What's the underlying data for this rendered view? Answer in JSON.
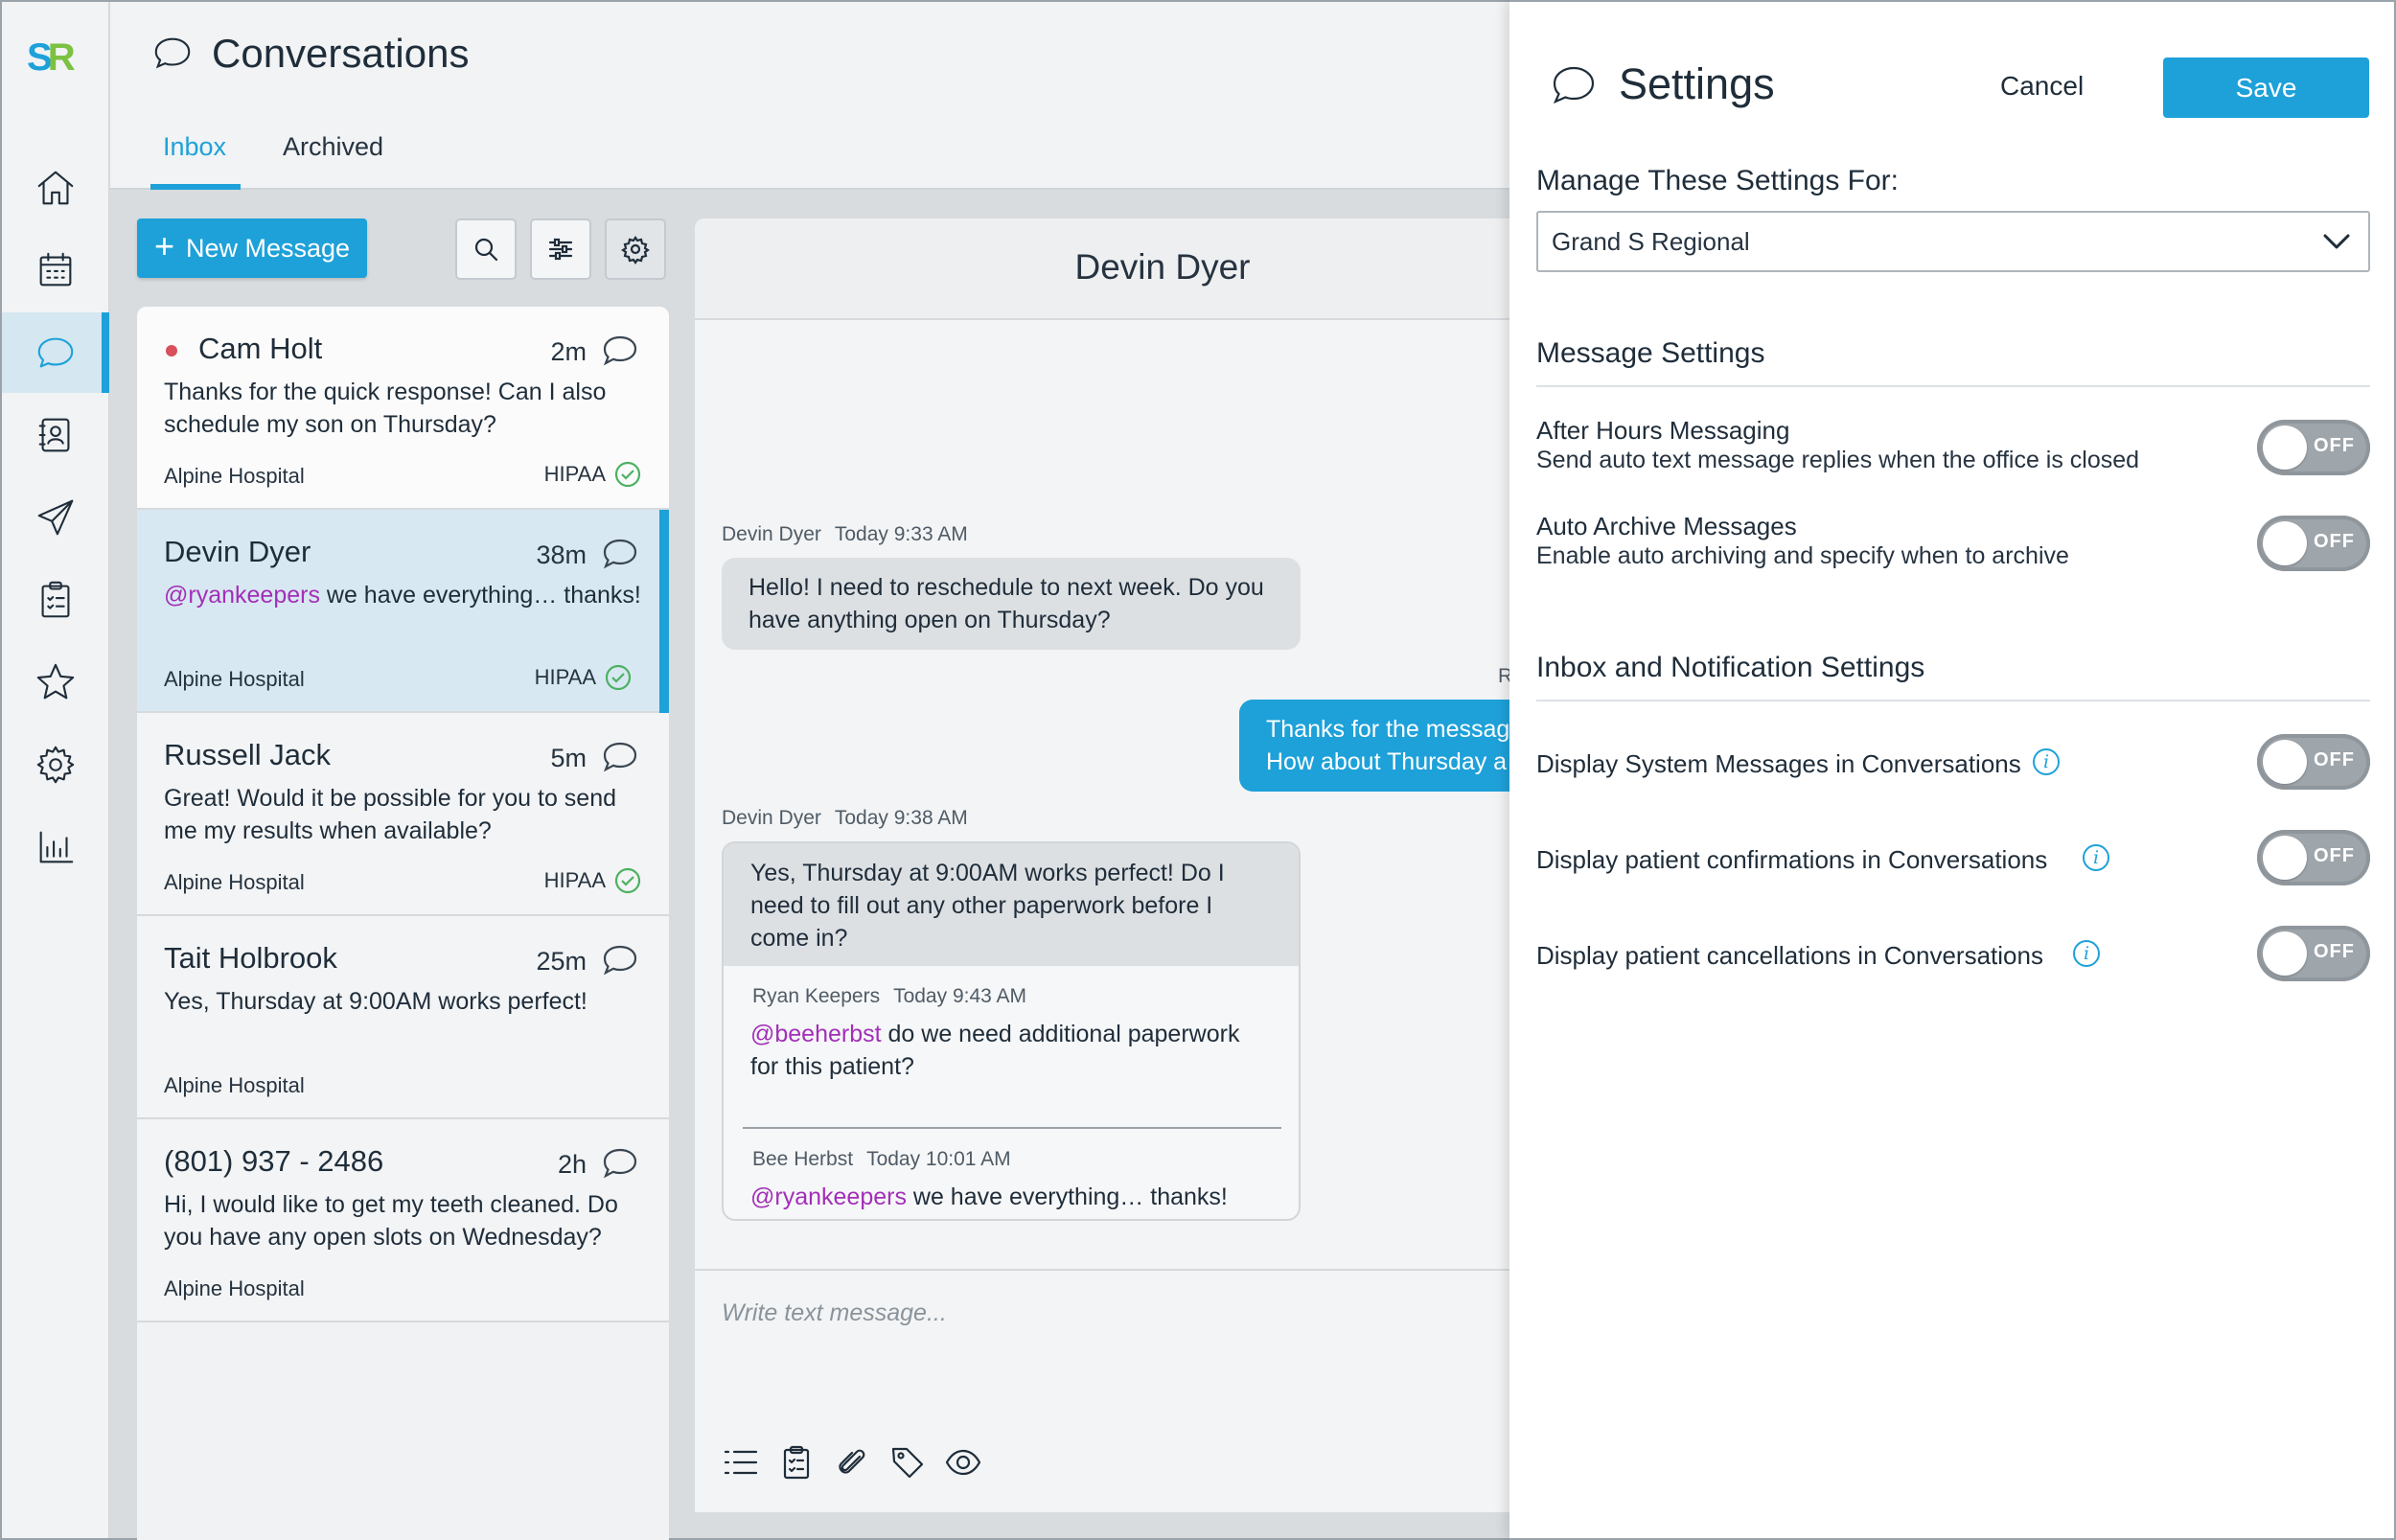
{
  "brand": {
    "logo_s": "S",
    "logo_r": "R",
    "accent": "#1ea1d9",
    "logo_green": "#7cc142"
  },
  "nav": {
    "items": [
      {
        "icon": "home-icon"
      },
      {
        "icon": "calendar-icon"
      },
      {
        "icon": "chat-icon",
        "active": true
      },
      {
        "icon": "contacts-icon"
      },
      {
        "icon": "send-icon"
      },
      {
        "icon": "clipboard-icon"
      },
      {
        "icon": "star-icon"
      },
      {
        "icon": "gear-icon"
      },
      {
        "icon": "analytics-icon"
      }
    ]
  },
  "header": {
    "title": "Conversations",
    "tabs": [
      {
        "label": "Inbox",
        "active": true
      },
      {
        "label": "Archived",
        "active": false
      }
    ]
  },
  "toolbar": {
    "new_message_label": "New Message",
    "plus": "+"
  },
  "conversations": [
    {
      "name": "Cam Holt",
      "time": "2m",
      "unread": true,
      "preview": "Thanks for the quick response! Can I also schedule my son on Thursday?",
      "org": "Alpine Hospital",
      "hipaa": "HIPAA"
    },
    {
      "name": "Devin Dyer",
      "time": "38m",
      "mention": "@ryankeepers",
      "preview": " we have everything… thanks!",
      "org": "Alpine Hospital",
      "hipaa": "HIPAA",
      "active": true
    },
    {
      "name": "Russell Jack",
      "time": "5m",
      "preview": "Great! Would it be possible for you to send me my results when available?",
      "org": "Alpine Hospital",
      "hipaa": "HIPAA"
    },
    {
      "name": "Tait Holbrook",
      "time": "25m",
      "preview": "Yes, Thursday at 9:00AM works perfect!",
      "org": "Alpine Hospital"
    },
    {
      "name": "(801) 937 - 2486",
      "time": "2h",
      "preview": "Hi, I would like to get my teeth cleaned. Do you have any open slots on Wednesday?",
      "org": "Alpine Hospital"
    }
  ],
  "chat": {
    "title": "Devin Dyer",
    "messages": [
      {
        "author": "Devin Dyer",
        "time": "Today 9:33 AM",
        "text": "Hello! I need to reschedule to next week. Do you have anything open on Thursday?"
      },
      {
        "outgoing_meta": "R",
        "text_line1": "Thanks for the messag",
        "text_line2": "How about Thursday a"
      },
      {
        "author": "Devin Dyer",
        "time": "Today 9:38 AM",
        "text": "Yes, Thursday at 9:00AM works perfect! Do I need to fill out any other paperwork before I come in?"
      }
    ],
    "thread": [
      {
        "author": "Ryan Keepers",
        "time": "Today 9:43 AM",
        "mention": "@beeherbst",
        "text": " do we need additional paperwork for this patient?"
      },
      {
        "author": "Bee Herbst",
        "time": "Today 10:01 AM",
        "mention": "@ryankeepers",
        "text": " we have everything… thanks!"
      }
    ],
    "composer_placeholder": "Write text message..."
  },
  "settings": {
    "title": "Settings",
    "cancel_label": "Cancel",
    "save_label": "Save",
    "manage_label": "Manage These Settings For:",
    "manage_value": "Grand S Regional",
    "message_section": "Message Settings",
    "after_hours_title": "After Hours Messaging",
    "after_hours_desc": "Send auto text message replies when the office is closed",
    "after_hours_state": "OFF",
    "auto_archive_title": "Auto Archive Messages",
    "auto_archive_desc": "Enable auto archiving and specify when to archive",
    "auto_archive_state": "OFF",
    "inbox_section": "Inbox and Notification Settings",
    "system_msgs_title": "Display System Messages in Conversations",
    "system_msgs_state": "OFF",
    "confirmations_title": "Display patient confirmations in Conversations",
    "confirmations_state": "OFF",
    "cancellations_title": "Display patient cancellations in Conversations",
    "cancellations_state": "OFF",
    "info_glyph": "i"
  }
}
